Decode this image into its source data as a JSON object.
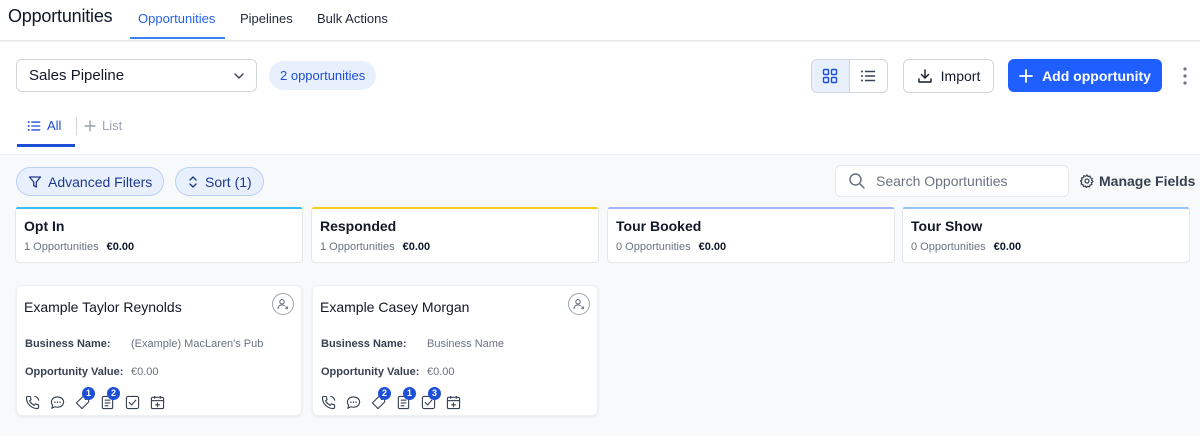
{
  "header": {
    "title": "Opportunities",
    "tabs": [
      {
        "label": "Opportunities",
        "active": true
      },
      {
        "label": "Pipelines",
        "active": false
      },
      {
        "label": "Bulk Actions",
        "active": false
      }
    ]
  },
  "toolbar": {
    "pipeline_select": "Sales Pipeline",
    "count_badge": "2 opportunities",
    "import_label": "Import",
    "add_label": "Add opportunity"
  },
  "views": {
    "all_label": "All",
    "list_label": "List"
  },
  "filters": {
    "advanced_label": "Advanced Filters",
    "sort_label": "Sort (1)",
    "search_placeholder": "Search Opportunities",
    "manage_fields_label": "Manage Fields"
  },
  "stages": [
    {
      "name": "Opt In",
      "count": "1 Opportunities",
      "value": "€0.00",
      "color": "#38bdf8"
    },
    {
      "name": "Responded",
      "count": "1 Opportunities",
      "value": "€0.00",
      "color": "#facc15"
    },
    {
      "name": "Tour Booked",
      "count": "0 Opportunities",
      "value": "€0.00",
      "color": "#a5b4fc"
    },
    {
      "name": "Tour Show",
      "count": "0 Opportunities",
      "value": "€0.00",
      "color": "#93c5fd"
    }
  ],
  "cards": [
    {
      "title": "Example Taylor Reynolds",
      "business_label": "Business Name:",
      "business_value": "(Example) MacLaren's Pub",
      "value_label": "Opportunity Value:",
      "value_value": "€0.00",
      "badges": {
        "tasks": "1",
        "notes": "2"
      }
    },
    {
      "title": "Example Casey Morgan",
      "business_label": "Business Name:",
      "business_value": "Business Name",
      "value_label": "Opportunity Value:",
      "value_value": "€0.00",
      "badges": {
        "tasks": "2",
        "notes": "1",
        "checks": "3"
      }
    }
  ],
  "colors": {
    "accent": "#1f5eff",
    "tab_active": "#2563eb"
  }
}
